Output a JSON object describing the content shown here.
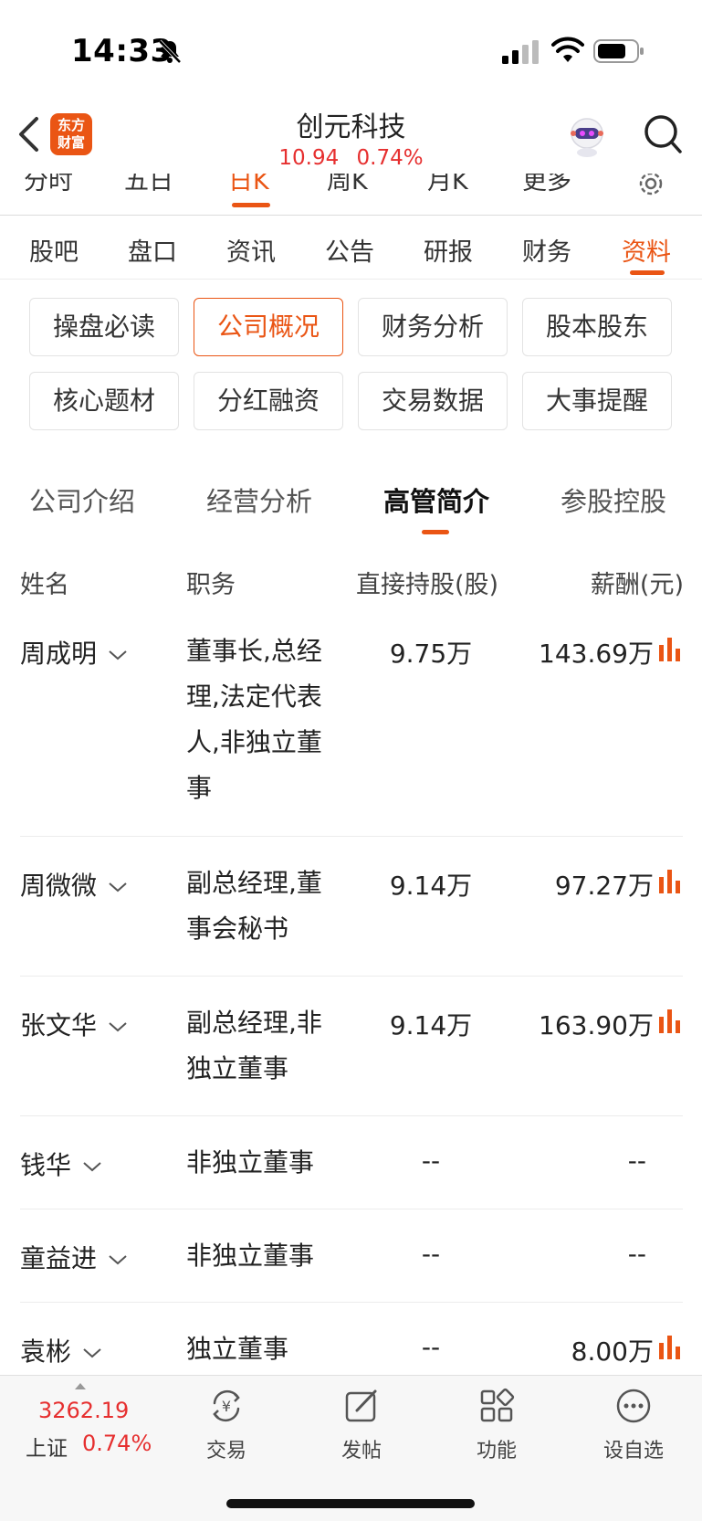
{
  "status_bar": {
    "time": "14:33"
  },
  "header": {
    "logo_line1": "东方",
    "logo_line2": "财富",
    "title": "创元科技",
    "price": "10.94",
    "change_pct": "0.74%"
  },
  "chart_tabs": [
    "分时",
    "五日",
    "日K",
    "周K",
    "月K",
    "更多"
  ],
  "main_tabs": [
    "股吧",
    "盘口",
    "资讯",
    "公告",
    "研报",
    "财务",
    "资料"
  ],
  "grid_buttons": [
    "操盘必读",
    "公司概况",
    "财务分析",
    "股本股东",
    "核心题材",
    "分红融资",
    "交易数据",
    "大事提醒"
  ],
  "sub_tabs": [
    "公司介绍",
    "经营分析",
    "高管简介",
    "参股控股"
  ],
  "table": {
    "headers": [
      "姓名",
      "职务",
      "直接持股(股)",
      "薪酬(元)"
    ],
    "rows": [
      {
        "name": "周成明",
        "role": "董事长,总经理,法定代表人,非独立董事",
        "shares": "9.75万",
        "pay": "143.69万"
      },
      {
        "name": "周微微",
        "role": "副总经理,董事会秘书",
        "shares": "9.14万",
        "pay": "97.27万"
      },
      {
        "name": "张文华",
        "role": "副总经理,非独立董事",
        "shares": "9.14万",
        "pay": "163.90万"
      },
      {
        "name": "钱华",
        "role": "非独立董事",
        "shares": "--",
        "pay": "--"
      },
      {
        "name": "童益进",
        "role": "非独立董事",
        "shares": "--",
        "pay": "--"
      },
      {
        "name": "袁彬",
        "role": "独立董事",
        "shares": "--",
        "pay": "8.00万"
      }
    ]
  },
  "bottom_bar": {
    "index_value": "3262.19",
    "index_name": "上证",
    "index_pct": "0.74%",
    "items": [
      "交易",
      "发帖",
      "功能",
      "设自选"
    ]
  },
  "colors": {
    "accent": "#ea5514",
    "up_red": "#e62f2f"
  }
}
